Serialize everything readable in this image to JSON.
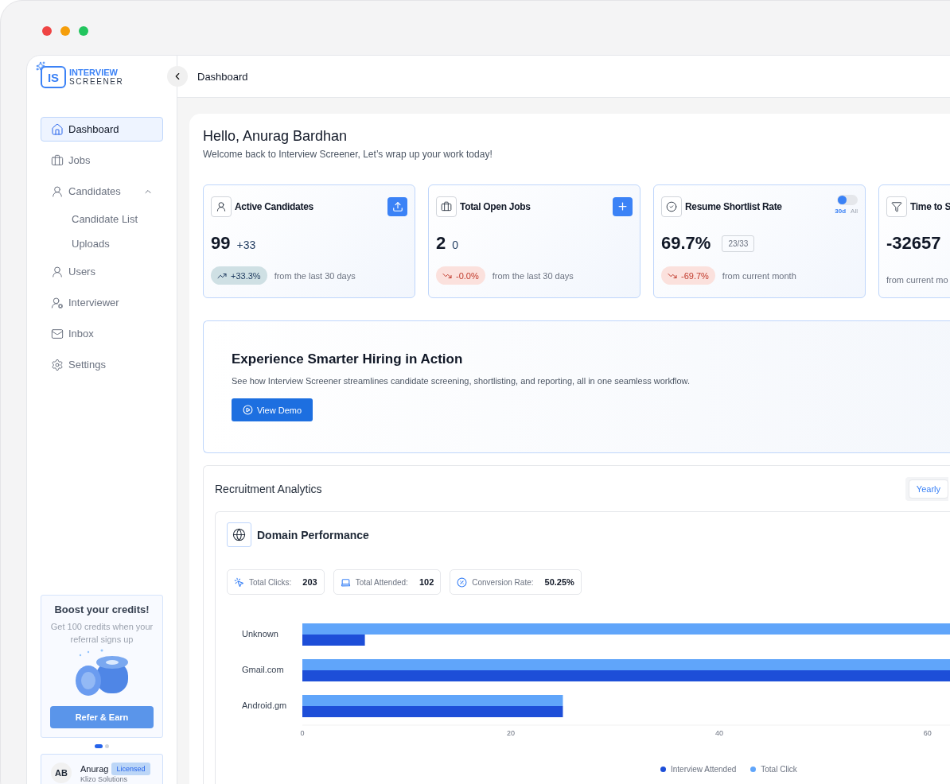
{
  "logo": {
    "mark": "IS",
    "line1": "INTERVIEW",
    "line2": "SCREENER"
  },
  "header": {
    "title": "Dashboard"
  },
  "sidebar": {
    "items": [
      {
        "label": "Dashboard",
        "kind": "home",
        "selected": true
      },
      {
        "label": "Jobs",
        "kind": "jobs",
        "selected": false
      },
      {
        "label": "Candidates",
        "kind": "candidates",
        "selected": false,
        "expanded": true,
        "children": [
          {
            "label": "Candidate List",
            "selected": false
          },
          {
            "label": "Uploads",
            "selected": false
          }
        ]
      },
      {
        "label": "Users",
        "kind": "users",
        "selected": false
      },
      {
        "label": "Interviewer",
        "kind": "interviewer",
        "selected": false
      },
      {
        "label": "Inbox",
        "kind": "inbox",
        "selected": false
      },
      {
        "label": "Settings",
        "kind": "settings",
        "selected": false
      }
    ]
  },
  "referral": {
    "title": "Boost your credits!",
    "text": "Get 100 credits when your referral signs up",
    "button": "Refer & Earn",
    "pages": [
      {
        "selected": true
      },
      {
        "selected": false
      }
    ]
  },
  "user": {
    "initials": "AB",
    "name": "Anurag",
    "badge": "Licensed",
    "company": "Klizo Solutions"
  },
  "greeting": {
    "title": "Hello, Anurag Bardhan",
    "subtitle": "Welcome back to Interview Screener, Let’s wrap up your work today!"
  },
  "stat_cards": [
    {
      "kind": "candidates",
      "title": "Active Candidates",
      "action": {
        "kind": "upload"
      },
      "value": "99",
      "delta": "+33",
      "change": {
        "kind": "up",
        "text": "+33.3%"
      },
      "note": "from the last 30 days"
    },
    {
      "kind": "jobs",
      "title": "Total Open Jobs",
      "action": {
        "kind": "add"
      },
      "value": "2",
      "delta": "0",
      "change": {
        "kind": "down",
        "text": "-0.0%"
      },
      "note": "from the last 30 days"
    },
    {
      "kind": "shortlist",
      "title": "Resume Shortlist Rate",
      "action": {
        "kind": "toggle",
        "on": false,
        "options": [
          {
            "label": "30d",
            "selected": true
          },
          {
            "label": "All",
            "selected": false
          }
        ]
      },
      "value": "69.7%",
      "ratio": "23/33",
      "change": {
        "kind": "down",
        "text": "-69.7%"
      },
      "note": "from current month"
    },
    {
      "kind": "time",
      "title": "Time to S",
      "value": "-32657",
      "note": "from current mo"
    }
  ],
  "banner": {
    "title": "Experience Smarter Hiring in Action",
    "text": "See how Interview Screener streamlines candidate screening, shortlisting, and reporting, all in one seamless workflow.",
    "button": "View Demo"
  },
  "analytics": {
    "title": "Recruitment Analytics",
    "period": "Yearly",
    "panel": {
      "title": "Domain Performance",
      "stats": [
        {
          "kind": "clicks",
          "label": "Total Clicks:",
          "value": "203"
        },
        {
          "kind": "attended",
          "label": "Total Attended:",
          "value": "102"
        },
        {
          "kind": "conversion",
          "label": "Conversion Rate:",
          "value": "50.25%"
        }
      ],
      "chart_data": {
        "type": "bar",
        "orientation": "horizontal",
        "categories": [
          "Unknown",
          "Gmail.com",
          "Android.gm"
        ],
        "series": [
          {
            "name": "Interview Attended",
            "color": "#1d4ed8",
            "values": [
              6,
              62.3,
              25
            ]
          },
          {
            "name": "Total Click",
            "color": "#60a5fa",
            "values": [
              62.3,
              62.3,
              25
            ]
          }
        ],
        "xlim": [
          0,
          62.3
        ],
        "xticks": [
          0,
          20,
          40,
          60
        ]
      }
    }
  }
}
